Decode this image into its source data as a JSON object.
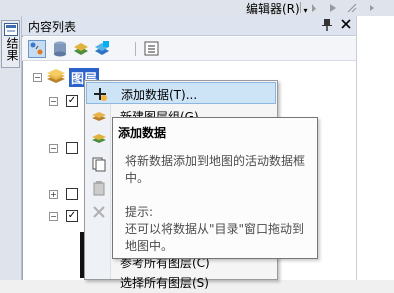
{
  "editor_toolbar": {
    "editor_label": "编辑器(R)",
    "dropdown_arrow": "▾"
  },
  "side_tab": {
    "label": "结果"
  },
  "panel": {
    "title": "内容列表",
    "pin_glyph": "ᵖ",
    "close_glyph": "✕"
  },
  "tree": {
    "root_label": "图层",
    "expand_symbol": "⊟",
    "collapse_symbol": "⊞",
    "checked_mark": "✓"
  },
  "context_menu": {
    "items": [
      {
        "label": "添加数据(T)..."
      },
      {
        "label": "新建图层组(G)"
      },
      {
        "label": ""
      },
      {
        "label": ""
      },
      {
        "label": ""
      },
      {
        "label": ""
      },
      {
        "label": ""
      },
      {
        "label": "参考所有图层(C)"
      },
      {
        "label": "选择所有图层(S)"
      }
    ]
  },
  "tooltip": {
    "title": "添加数据",
    "line1": "将新数据添加到地图的活动数据框",
    "line2": "中。",
    "line3": "提示:",
    "line4": "还可以将数据从\"目录\"窗口拖动到",
    "line5": "地图中。"
  },
  "colors": {
    "highlight": "#2a62c9",
    "menu_hover": "#cde4f7",
    "panel_title_bg": "#dde4ef"
  }
}
